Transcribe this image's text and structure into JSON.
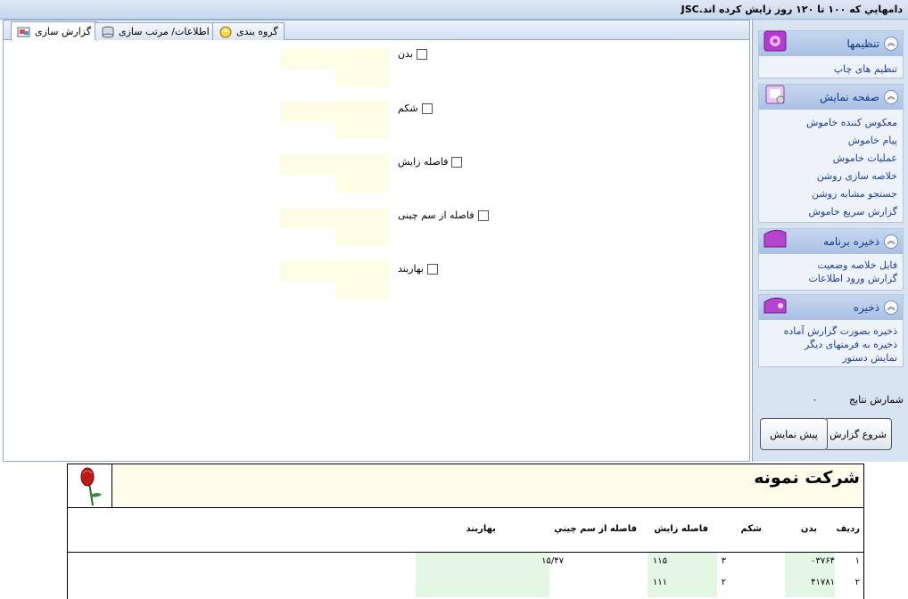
{
  "window": {
    "title": "دامهايي كه ۱۰۰ تا ۱۲۰ روز زايش كرده اند.JSC"
  },
  "tabs": [
    {
      "label": "گزارش سازی",
      "active": true
    },
    {
      "label": "اطلاعات/ مرتب سازی",
      "active": false
    },
    {
      "label": "گروه بندی",
      "active": false
    }
  ],
  "fields": [
    {
      "label": "بدن",
      "checked": false
    },
    {
      "label": "شکم",
      "checked": false
    },
    {
      "label": "فاصله زایش",
      "checked": false
    },
    {
      "label": "فاصله از سم چینی",
      "checked": false
    },
    {
      "label": "بهاربند",
      "checked": false
    }
  ],
  "panel": {
    "settings": {
      "title": "تنظیمها",
      "items": [
        "تنظیم های چاپ"
      ]
    },
    "display": {
      "title": "صفحه نمایش",
      "items": [
        "معکوس کننده خاموش",
        "پیام خاموش",
        "عملیات خاموش",
        "خلاصه سازی روشن",
        "جستجو مشابه روشن",
        "گزارش سریع خاموش"
      ]
    },
    "save_program": {
      "title": "ذخیره برنامه",
      "items": [
        "فایل خلاصه وضعیت",
        "گزارش ورود اطلاعات"
      ]
    },
    "save": {
      "title": "ذخیره",
      "items": [
        "ذخیره بصورت گزارش آماده",
        "ذخیره به فرمتهای دیگر",
        "نمایش دستور"
      ]
    },
    "result_count_label": "شمارش نتایج",
    "result_count_value": "۰",
    "start_button": "شروع گزارش",
    "preview_button": "پیش نمایش"
  },
  "report": {
    "company": "شرکت نمونه",
    "columns": [
      "ردیف",
      "بدن",
      "شکم",
      "فاصله زایش",
      "فاصله از سم چيني",
      "بهاربند"
    ],
    "rows": [
      {
        "row": "۱",
        "body": "۰۳۷۶۴",
        "belly": "۳",
        "calving": "۱۱۵",
        "hoof": "۱۵/۴۷"
      },
      {
        "row": "۲",
        "body": "۴۱۷۸۱",
        "belly": "۲",
        "calving": "۱۱۱",
        "hoof": ""
      }
    ]
  },
  "colors": {
    "accent": "#1b3fa0",
    "panel_bg": "#d8e3f2",
    "yellow_box": "#fdfde6",
    "green_cell": "#e4f7e4"
  }
}
